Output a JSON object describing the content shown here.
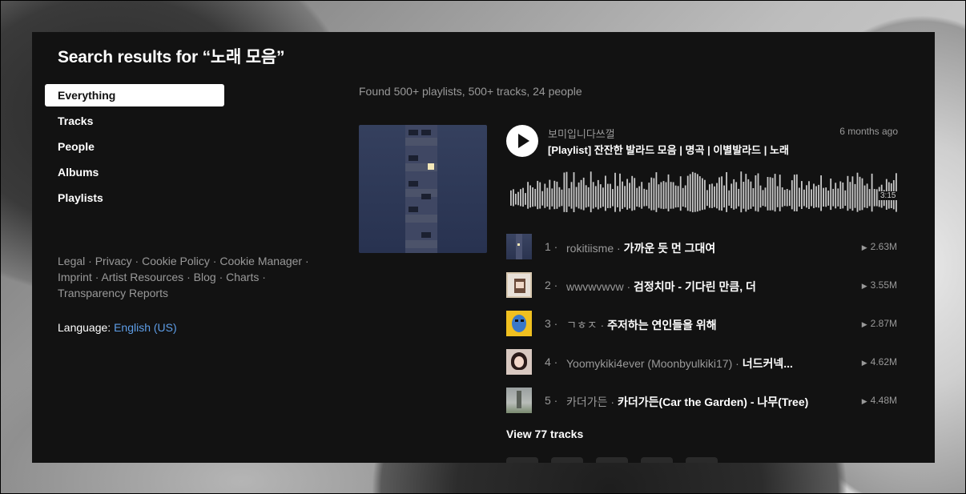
{
  "page": {
    "title": "Search results for “노래 모음”",
    "found": "Found 500+ playlists, 500+ tracks, 24 people"
  },
  "nav": {
    "items": [
      {
        "label": "Everything",
        "active": true
      },
      {
        "label": "Tracks"
      },
      {
        "label": "People"
      },
      {
        "label": "Albums"
      },
      {
        "label": "Playlists"
      }
    ]
  },
  "footer": {
    "links": [
      "Legal",
      "Privacy",
      "Cookie Policy",
      "Cookie Manager",
      "Imprint",
      "Artist Resources",
      "Blog",
      "Charts",
      "Transparency Reports"
    ],
    "separator": "·",
    "language_label": "Language:",
    "language_value": "English (US)"
  },
  "playlist": {
    "uploader": "보미입니다쓰껄",
    "title": "[Playlist] 잔잔한 발라드 모음 | 명곡 | 이별발라드 | 노래",
    "posted": "6 months ago",
    "duration": "3:15",
    "view_all": "View 77 tracks",
    "tracks": [
      {
        "num": "1",
        "artist": "rokitiisme",
        "title": "가까운 듯 먼 그대여",
        "plays": "2.63M"
      },
      {
        "num": "2",
        "artist": "wwvwvwvw",
        "title": "검정치마 - 기다린 만큼, 더",
        "plays": "3.55M"
      },
      {
        "num": "3",
        "artist": "ㄱㅎㅈ",
        "title": "주저하는 연인들을 위해",
        "plays": "2.87M"
      },
      {
        "num": "4",
        "artist": "Yoomykiki4ever (Moonbyulkiki17)",
        "title": "너드커넥...",
        "plays": "4.62M"
      },
      {
        "num": "5",
        "artist": "카더가든",
        "title": "카더가든(Car the Garden) - 나무(Tree)",
        "plays": "4.48M"
      }
    ]
  },
  "icons": {
    "play": "play-icon",
    "plays_count": "play-count-icon"
  },
  "colors": {
    "panel_bg": "#121212",
    "link_blue": "#5e9ee8",
    "muted_text": "#999999"
  }
}
